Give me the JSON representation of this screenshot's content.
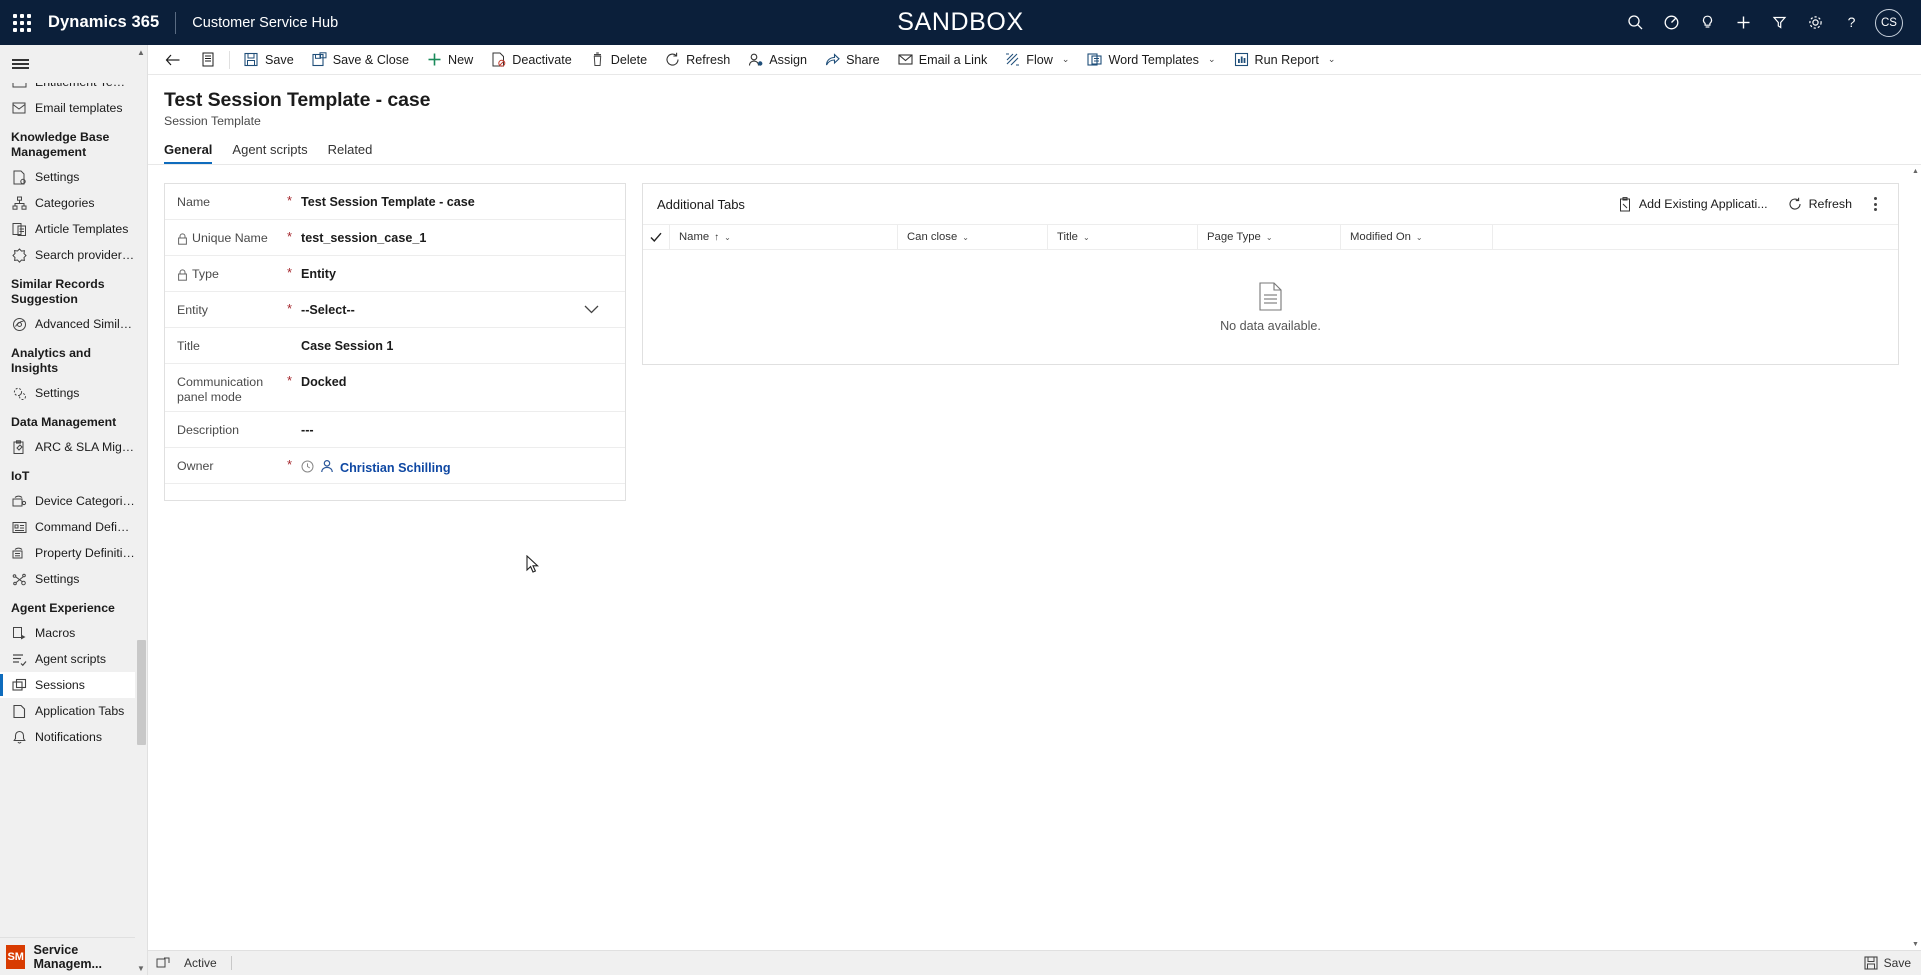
{
  "navbar": {
    "waffle": "app-launcher",
    "brand": "Dynamics 365",
    "app_name": "Customer Service Hub",
    "environment_banner": "SANDBOX",
    "icons": [
      {
        "name": "search-icon",
        "glyph": "search"
      },
      {
        "name": "assistant-icon",
        "glyph": "assistant"
      },
      {
        "name": "lightbulb-icon",
        "glyph": "bulb"
      },
      {
        "name": "quick-create-icon",
        "glyph": "plus"
      },
      {
        "name": "filter-icon",
        "glyph": "filter"
      },
      {
        "name": "settings-gear-icon",
        "glyph": "gear"
      },
      {
        "name": "help-icon",
        "glyph": "question"
      }
    ],
    "avatar_initials": "CS"
  },
  "commandbar": {
    "back": "back-arrow",
    "form_selector": "form-icon",
    "items": [
      {
        "label": "Save",
        "icon": "save-icon",
        "chevron": false
      },
      {
        "label": "Save & Close",
        "icon": "save-close-icon",
        "chevron": false
      },
      {
        "label": "New",
        "icon": "plus-icon",
        "chevron": false
      },
      {
        "label": "Deactivate",
        "icon": "deactivate-icon",
        "chevron": false
      },
      {
        "label": "Delete",
        "icon": "trash-icon",
        "chevron": false
      },
      {
        "label": "Refresh",
        "icon": "refresh-icon",
        "chevron": false
      },
      {
        "label": "Assign",
        "icon": "assign-icon",
        "chevron": false
      },
      {
        "label": "Share",
        "icon": "share-icon",
        "chevron": false
      },
      {
        "label": "Email a Link",
        "icon": "email-link-icon",
        "chevron": false
      },
      {
        "label": "Flow",
        "icon": "flow-icon",
        "chevron": true
      },
      {
        "label": "Word Templates",
        "icon": "word-template-icon",
        "chevron": true
      },
      {
        "label": "Run Report",
        "icon": "report-icon",
        "chevron": true
      }
    ]
  },
  "page": {
    "title": "Test Session Template - case",
    "subtitle": "Session Template",
    "tabs": [
      {
        "label": "General",
        "active": true
      },
      {
        "label": "Agent scripts",
        "active": false
      },
      {
        "label": "Related",
        "active": false
      }
    ]
  },
  "form": {
    "fields": [
      {
        "label": "Name",
        "value": "Test Session Template - case",
        "required": true,
        "locked": false,
        "type": "text"
      },
      {
        "label": "Unique Name",
        "value": "test_session_case_1",
        "required": true,
        "locked": true,
        "type": "text"
      },
      {
        "label": "Type",
        "value": "Entity",
        "required": true,
        "locked": true,
        "type": "text"
      },
      {
        "label": "Entity",
        "value": "--Select--",
        "required": true,
        "locked": false,
        "type": "dropdown"
      },
      {
        "label": "Title",
        "value": "Case Session 1",
        "required": false,
        "locked": false,
        "type": "text"
      },
      {
        "label": "Communication panel mode",
        "value": "Docked",
        "required": true,
        "locked": false,
        "type": "text"
      },
      {
        "label": "Description",
        "value": "---",
        "required": false,
        "locked": false,
        "type": "text"
      },
      {
        "label": "Owner",
        "value": "Christian Schilling",
        "required": true,
        "locked": false,
        "type": "lookup"
      }
    ]
  },
  "grid": {
    "title": "Additional Tabs",
    "actions": [
      {
        "label": "Add Existing Applicati...",
        "icon": "add-existing-icon"
      },
      {
        "label": "Refresh",
        "icon": "refresh-icon"
      }
    ],
    "more_label": "more-commands",
    "columns": [
      {
        "label": "Name",
        "sorted": "asc"
      },
      {
        "label": "Can close",
        "sorted": ""
      },
      {
        "label": "Title",
        "sorted": ""
      },
      {
        "label": "Page Type",
        "sorted": ""
      },
      {
        "label": "Modified On",
        "sorted": ""
      }
    ],
    "rows": [],
    "empty_message": "No data available."
  },
  "sidebar": {
    "groups": [
      {
        "title": "",
        "items": [
          {
            "label": "Entitlement Templ...",
            "icon": "entitlement-template-icon",
            "active": false,
            "clipped": true
          },
          {
            "label": "Email templates",
            "icon": "email-template-icon",
            "active": false
          }
        ]
      },
      {
        "title": "Knowledge Base Management",
        "items": [
          {
            "label": "Settings",
            "icon": "settings-doc-icon",
            "active": false
          },
          {
            "label": "Categories",
            "icon": "categories-icon",
            "active": false
          },
          {
            "label": "Article Templates",
            "icon": "article-template-icon",
            "active": false
          },
          {
            "label": "Search providers (...",
            "icon": "search-providers-icon",
            "active": false
          }
        ]
      },
      {
        "title": "Similar Records Suggestion",
        "items": [
          {
            "label": "Advanced Similari...",
            "icon": "advanced-similarity-icon",
            "active": false
          }
        ]
      },
      {
        "title": "Analytics and Insights",
        "items": [
          {
            "label": "Settings",
            "icon": "analytics-settings-icon",
            "active": false
          }
        ]
      },
      {
        "title": "Data Management",
        "items": [
          {
            "label": "ARC & SLA Migra...",
            "icon": "arc-sla-migration-icon",
            "active": false
          }
        ]
      },
      {
        "title": "IoT",
        "items": [
          {
            "label": "Device Categories",
            "icon": "device-categories-icon",
            "active": false
          },
          {
            "label": "Command Definit...",
            "icon": "command-definition-icon",
            "active": false
          },
          {
            "label": "Property Definitio...",
            "icon": "property-definition-icon",
            "active": false
          },
          {
            "label": "Settings",
            "icon": "iot-settings-icon",
            "active": false
          }
        ]
      },
      {
        "title": "Agent Experience",
        "items": [
          {
            "label": "Macros",
            "icon": "macros-icon",
            "active": false
          },
          {
            "label": "Agent scripts",
            "icon": "agent-scripts-icon",
            "active": false
          },
          {
            "label": "Sessions",
            "icon": "sessions-icon",
            "active": true
          },
          {
            "label": "Application Tabs",
            "icon": "application-tabs-icon",
            "active": false
          },
          {
            "label": "Notifications",
            "icon": "notifications-icon",
            "active": false
          }
        ]
      }
    ],
    "area_switcher": {
      "initials": "SM",
      "label": "Service Managem..."
    }
  },
  "footer": {
    "expand_icon": "expand-icon",
    "status": "Active",
    "save_label": "Save",
    "save_icon": "save-icon"
  },
  "colors": {
    "navbar_bg": "#0b1f3a",
    "accent": "#0f6cbd",
    "required": "#a4262c",
    "link": "#0f48a3",
    "sidebar_bg": "#f0f0f0",
    "tile_orange": "#d83b01"
  }
}
